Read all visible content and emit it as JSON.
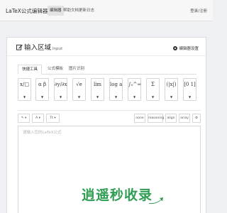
{
  "nav": {
    "brand": "LaTeX公式编辑器",
    "version": "ver1.8.2",
    "tabs": [
      "编辑器",
      "帮助文档",
      "更新日志"
    ],
    "active_tab": 0,
    "login": "登录/注册"
  },
  "panel": {
    "title": "输入区域",
    "title_sub": "Input",
    "settings": "编辑器设置",
    "subtabs": [
      "快捷工具",
      "公式模板",
      "图片识别"
    ],
    "active_subtab": 0
  },
  "symbols": [
    {
      "name": "fraction",
      "glyph": "x/□"
    },
    {
      "name": "greek",
      "glyph": "α β"
    },
    {
      "name": "derivative",
      "glyph": "∂y/∂x"
    },
    {
      "name": "sqrt",
      "glyph": "√e"
    },
    {
      "name": "limit",
      "glyph": "lim"
    },
    {
      "name": "log",
      "glyph": "log a"
    },
    {
      "name": "integral",
      "glyph": "∫₀^∞"
    },
    {
      "name": "sum",
      "glyph": "Σ"
    },
    {
      "name": "brackets",
      "glyph": "(|x|)"
    },
    {
      "name": "matrix",
      "glyph": "[0 1]"
    }
  ],
  "toolbar": {
    "format_buttons": [
      "✎",
      "A",
      "Tt"
    ],
    "right_buttons": [
      "none",
      "reasoning",
      "align",
      "array",
      "⚙"
    ]
  },
  "editor": {
    "placeholder": "请输入您的LaTeX公式"
  },
  "watermark": {
    "text": "逍遥秒收录",
    "color": "#2f9e52"
  }
}
